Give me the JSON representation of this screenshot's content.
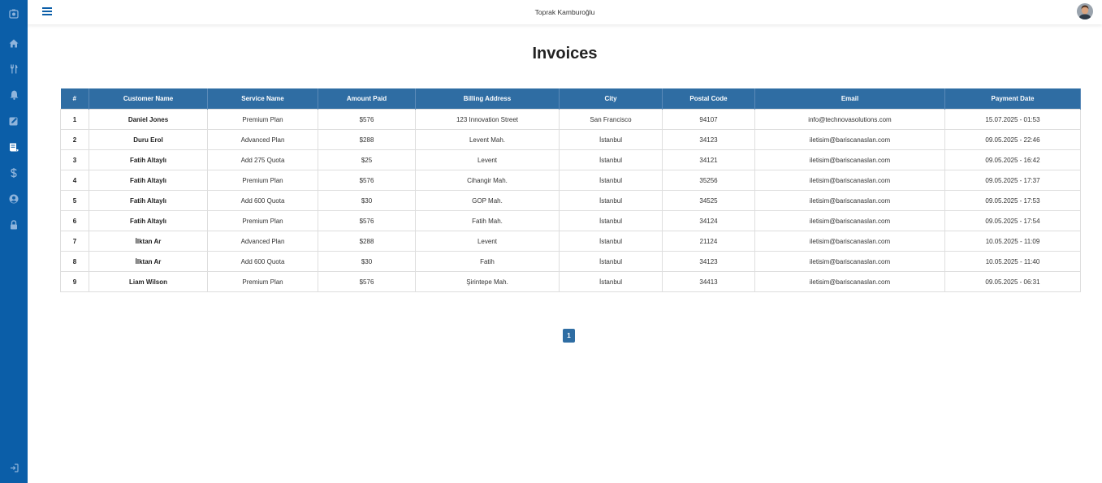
{
  "header": {
    "user_name": "Toprak Kamburoğlu"
  },
  "sidebar": {
    "items": [
      {
        "icon": "logo-icon",
        "active": false
      },
      {
        "icon": "home-icon",
        "active": false
      },
      {
        "icon": "utensils-icon",
        "active": false
      },
      {
        "icon": "bell-icon",
        "active": false
      },
      {
        "icon": "edit-icon",
        "active": false
      },
      {
        "icon": "invoice-icon",
        "active": true
      },
      {
        "icon": "dollar-icon",
        "active": false
      },
      {
        "icon": "user-circle-icon",
        "active": false
      },
      {
        "icon": "lock-icon",
        "active": false
      }
    ],
    "logout_icon": "sign-out-icon"
  },
  "page": {
    "title": "Invoices"
  },
  "table": {
    "columns": [
      "#",
      "Customer Name",
      "Service Name",
      "Amount Paid",
      "Billing Address",
      "City",
      "Postal Code",
      "Email",
      "Payment Date"
    ],
    "rows": [
      [
        "1",
        "Daniel Jones",
        "Premium Plan",
        "$576",
        "123 Innovation Street",
        "San Francisco",
        "94107",
        "info@technovasolutions.com",
        "15.07.2025 - 01:53"
      ],
      [
        "2",
        "Duru Erol",
        "Advanced Plan",
        "$288",
        "Levent Mah.",
        "İstanbul",
        "34123",
        "iletisim@bariscanaslan.com",
        "09.05.2025 - 22:46"
      ],
      [
        "3",
        "Fatih Altaylı",
        "Add 275 Quota",
        "$25",
        "Levent",
        "İstanbul",
        "34121",
        "iletisim@bariscanaslan.com",
        "09.05.2025 - 16:42"
      ],
      [
        "4",
        "Fatih Altaylı",
        "Premium Plan",
        "$576",
        "Cihangir Mah.",
        "İstanbul",
        "35256",
        "iletisim@bariscanaslan.com",
        "09.05.2025 - 17:37"
      ],
      [
        "5",
        "Fatih Altaylı",
        "Add 600 Quota",
        "$30",
        "GOP Mah.",
        "İstanbul",
        "34525",
        "iletisim@bariscanaslan.com",
        "09.05.2025 - 17:53"
      ],
      [
        "6",
        "Fatih Altaylı",
        "Premium Plan",
        "$576",
        "Fatih Mah.",
        "İstanbul",
        "34124",
        "iletisim@bariscanaslan.com",
        "09.05.2025 - 17:54"
      ],
      [
        "7",
        "İlktan Ar",
        "Advanced Plan",
        "$288",
        "Levent",
        "İstanbul",
        "21124",
        "iletisim@bariscanaslan.com",
        "10.05.2025 - 11:09"
      ],
      [
        "8",
        "İlktan Ar",
        "Add 600 Quota",
        "$30",
        "Fatih",
        "İstanbul",
        "34123",
        "iletisim@bariscanaslan.com",
        "10.05.2025 - 11:40"
      ],
      [
        "9",
        "Liam Wilson",
        "Premium Plan",
        "$576",
        "Şirintepe Mah.",
        "İstanbul",
        "34413",
        "iletisim@bariscanaslan.com",
        "09.05.2025 - 06:31"
      ]
    ]
  },
  "pagination": {
    "pages": [
      "1"
    ],
    "current": "1"
  },
  "colors": {
    "sidebar": "#0b5ea8",
    "table_header": "#2f6da3",
    "active_icon": "#ffffff",
    "inactive_icon": "#8fb4db"
  }
}
